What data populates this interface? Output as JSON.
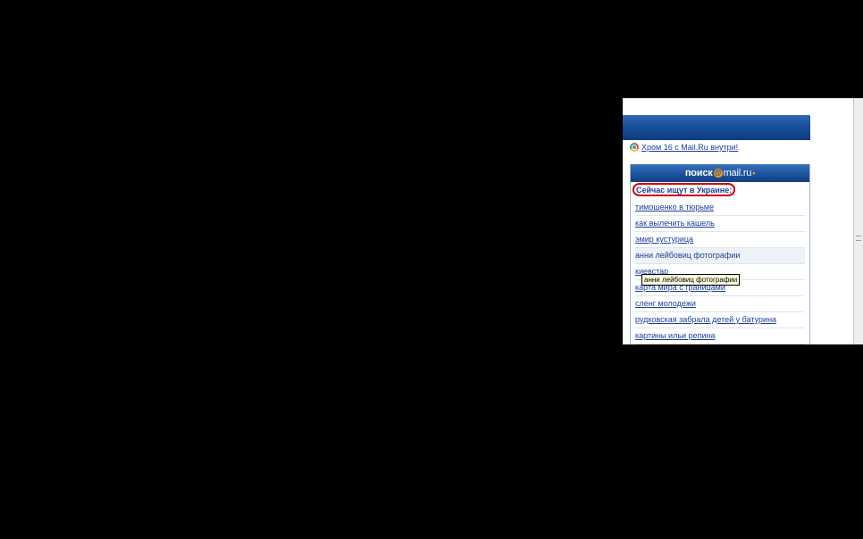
{
  "promo": {
    "icon": "chrome-icon",
    "link_text": "Хром 16 с Mail.Ru внутри!"
  },
  "widget": {
    "logo": {
      "text_left": "поиск",
      "at": "@",
      "text_right": "mail.ru",
      "dot": "•"
    },
    "title": "Сейчас ищут в Украине:",
    "queries": [
      "тимошенко в тюрьме",
      "как вылечить кашель",
      "эмир кустурица",
      "анни лейбовиц фотографии",
      "киевстар",
      "карта мира с границами",
      "сленг молодежи",
      "рудковская забрала детей у батурина",
      "картины ильи репина"
    ]
  },
  "tooltip": {
    "text": "анни лейбовиц фотографии"
  },
  "colors": {
    "link": "#1a3f9c",
    "header_blue": "#1e559f",
    "highlight": "#d00000",
    "tooltip_bg": "#ffffe1"
  }
}
